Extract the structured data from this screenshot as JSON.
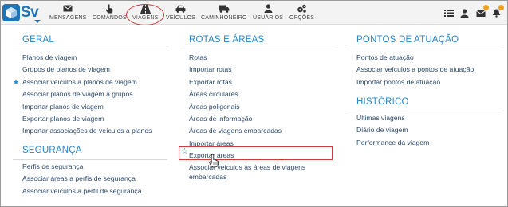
{
  "logo": {
    "text": "Sv"
  },
  "nav": {
    "items": [
      {
        "label": "MENSAGENS",
        "icon": "envelope-icon"
      },
      {
        "label": "COMANDOS",
        "icon": "hand-pointer-icon"
      },
      {
        "label": "VIAGENS",
        "icon": "road-icon",
        "active": true
      },
      {
        "label": "VEÍCULOS",
        "icon": "car-icon"
      },
      {
        "label": "CAMINHONEIRO",
        "icon": "truck-icon"
      },
      {
        "label": "USUÁRIOS",
        "icon": "user-icon"
      },
      {
        "label": "OPÇÕES",
        "icon": "cogs-icon"
      }
    ],
    "right_icons": [
      "list-icon",
      "user-icon",
      "envelope-icon",
      "bell-icon"
    ]
  },
  "menu": {
    "geral": {
      "title": "GERAL",
      "items": [
        "Planos de viagem",
        "Grupos de planos de viagem",
        "Associar veículos a planos de viagem",
        "Associar planos de viagem a grupos",
        "Importar planos de viagem",
        "Exportar planos de viagem",
        "Importar associações de veículos a planos"
      ]
    },
    "seguranca": {
      "title": "SEGURANÇA",
      "items": [
        "Perfis de segurança",
        "Associar áreas a perfis de segurança",
        "Associar veículos a perfil de segurança"
      ]
    },
    "rotas": {
      "title": "ROTAS E ÁREAS",
      "items": [
        "Rotas",
        "Importar rotas",
        "Exportar rotas",
        "Áreas circulares",
        "Áreas poligonais",
        "Áreas de informação",
        "Áreas de viagens embarcadas",
        "Importar áreas",
        "Exportar áreas",
        "Associar veículos às áreas de viagens",
        "embarcadas"
      ]
    },
    "pontos": {
      "title": "PONTOS DE ATUAÇÃO",
      "items": [
        "Pontos de atuação",
        "Associar veículos a pontos de atuação",
        "Importar pontos de atuação"
      ]
    },
    "historico": {
      "title": "HISTÓRICO",
      "items": [
        "Últimas viagens",
        "Diário de viagem",
        "Performance da viagem"
      ]
    }
  }
}
